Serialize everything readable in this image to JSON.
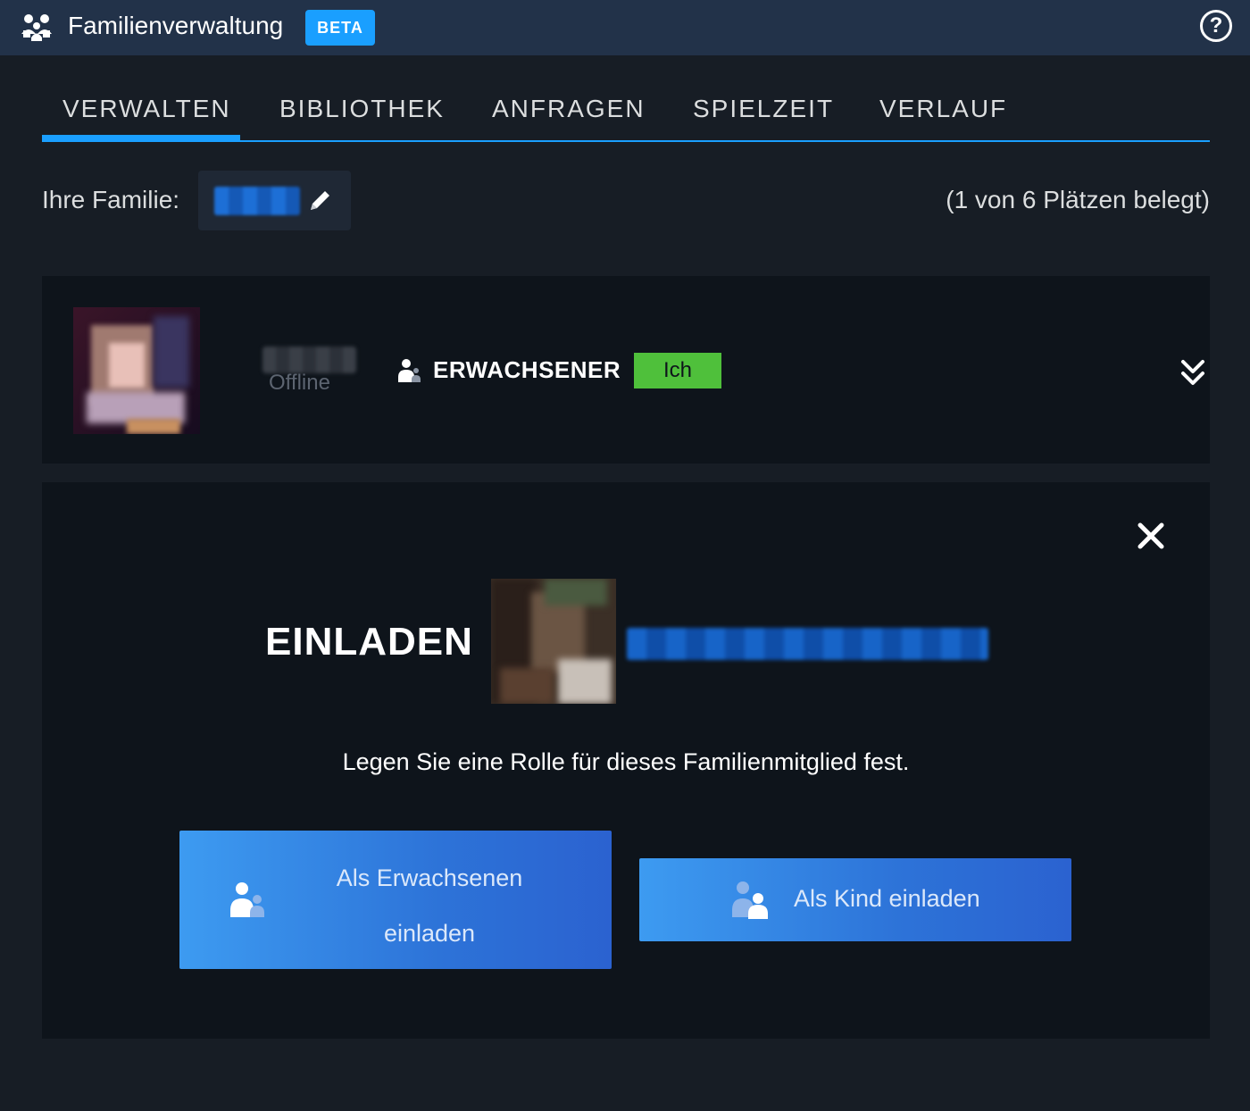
{
  "header": {
    "title": "Familienverwaltung",
    "beta_badge": "BETA",
    "help_glyph": "?"
  },
  "tabs": [
    {
      "label": "VERWALTEN",
      "active": true
    },
    {
      "label": "BIBLIOTHEK",
      "active": false
    },
    {
      "label": "ANFRAGEN",
      "active": false
    },
    {
      "label": "SPIELZEIT",
      "active": false
    },
    {
      "label": "VERLAUF",
      "active": false
    }
  ],
  "family": {
    "label": "Ihre Familie:",
    "slots": "(1 von 6 Plätzen belegt)"
  },
  "member": {
    "status": "Offline",
    "role": "ERWACHSENER",
    "me_badge": "Ich"
  },
  "invite": {
    "title": "EINLADEN",
    "description": "Legen Sie eine Rolle für dieses Familienmitglied fest.",
    "adult_button": {
      "line1": "Als Erwachsenen",
      "line2": "einladen"
    },
    "child_button": "Als Kind einladen"
  },
  "colors": {
    "accent": "#1a9fff",
    "header_bg": "#223249",
    "page_bg": "#171d25",
    "card_bg": "#0e141b",
    "me_badge": "#4fc03b"
  },
  "icons": {
    "family": "family-icon",
    "edit": "pencil-icon",
    "role": "adult-user-icon",
    "expand": "double-chevron-down-icon",
    "close": "close-icon",
    "help": "help-icon"
  }
}
